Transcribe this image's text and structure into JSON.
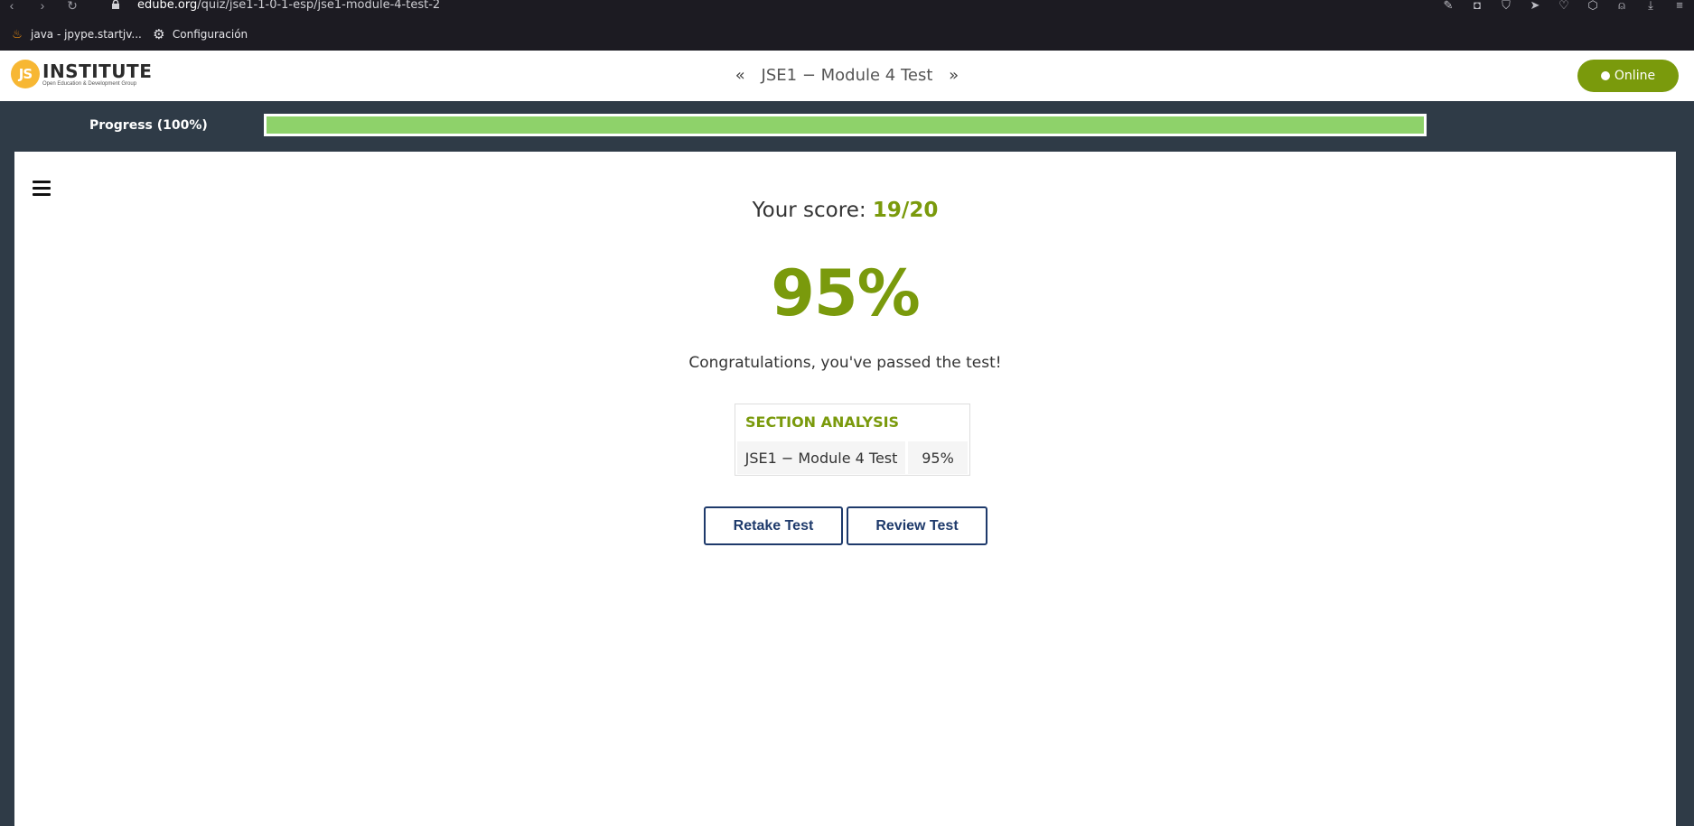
{
  "browser": {
    "url_host": "edube.org",
    "url_path": "/quiz/jse1-1-0-1-esp/jse1-module-4-test-2",
    "bookmarks": [
      {
        "label": "java - jpype.startjv...",
        "icon": "java-icon"
      },
      {
        "label": "Configuración",
        "icon": "gear-icon"
      }
    ]
  },
  "header": {
    "logo_badge": "JS",
    "logo_word": "INSTITUTE",
    "logo_sub": "Open Education & Development Group",
    "quiz_title": "JSE1 − Module 4 Test",
    "prev_arrow": "«",
    "next_arrow": "»",
    "status_label": "Online",
    "status_color": "#7a9a0c"
  },
  "progress": {
    "label": "Progress (100%)",
    "value_percent": 100,
    "fill_color": "#8ed26a"
  },
  "result": {
    "score_prefix": "Your score: ",
    "score_value": "19/20",
    "percent": "95%",
    "message": "Congratulations, you've passed the test!",
    "accent_color": "#7a9a0c"
  },
  "analysis": {
    "title": "SECTION ANALYSIS",
    "rows": [
      {
        "section": "JSE1 − Module 4 Test",
        "score": "95%"
      }
    ]
  },
  "actions": {
    "retake_label": "Retake Test",
    "review_label": "Review Test"
  }
}
